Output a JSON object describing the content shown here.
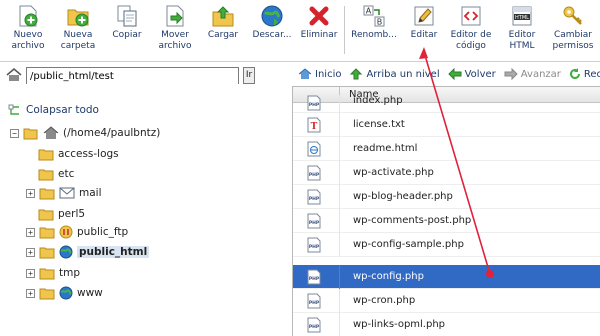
{
  "toolbar": {
    "items": [
      {
        "label": "Nuevo\narchivo",
        "icon": "new-file-icon"
      },
      {
        "label": "Nueva\ncarpeta",
        "icon": "new-folder-icon"
      },
      {
        "label": "Copiar",
        "icon": "copy-icon"
      },
      {
        "label": "Mover\narchivo",
        "icon": "move-file-icon"
      },
      {
        "label": "Cargar",
        "icon": "upload-icon"
      },
      {
        "label": "Descar...",
        "icon": "download-icon"
      },
      {
        "label": "Eliminar",
        "icon": "delete-icon"
      },
      {
        "label": "Renomb...",
        "icon": "rename-icon"
      },
      {
        "label": "Editar",
        "icon": "edit-icon"
      },
      {
        "label": "Editor de\ncódigo",
        "icon": "code-editor-icon"
      },
      {
        "label": "Editor\nHTML",
        "icon": "html-editor-icon"
      },
      {
        "label": "Cambiar\npermisos",
        "icon": "permissions-icon"
      }
    ]
  },
  "path": {
    "value": "/public_html/test",
    "go_label": "Ir"
  },
  "tree": {
    "collapse_label": "Colapsar todo",
    "root_label": "(/home4/paulbntz)",
    "items": [
      {
        "label": "access-logs",
        "expandable": false,
        "type": "folder"
      },
      {
        "label": "etc",
        "expandable": false,
        "type": "folder"
      },
      {
        "label": "mail",
        "expandable": true,
        "type": "mail"
      },
      {
        "label": "perl5",
        "expandable": false,
        "type": "folder"
      },
      {
        "label": "public_ftp",
        "expandable": true,
        "type": "ftp"
      },
      {
        "label": "public_html",
        "expandable": true,
        "type": "web",
        "selected": true
      },
      {
        "label": "tmp",
        "expandable": true,
        "type": "folder"
      },
      {
        "label": "www",
        "expandable": true,
        "type": "web"
      }
    ]
  },
  "nav": {
    "home": "Inicio",
    "up": "Arriba un nivel",
    "back": "Volver",
    "forward": "Avanzar",
    "reload": "Rec"
  },
  "files": {
    "column_name": "Name",
    "rows": [
      {
        "name": "index.php",
        "icon": "php-file-icon"
      },
      {
        "name": "license.txt",
        "icon": "text-file-icon"
      },
      {
        "name": "readme.html",
        "icon": "html-file-icon"
      },
      {
        "name": "wp-activate.php",
        "icon": "php-file-icon"
      },
      {
        "name": "wp-blog-header.php",
        "icon": "php-file-icon"
      },
      {
        "name": "wp-comments-post.php",
        "icon": "php-file-icon"
      },
      {
        "name": "wp-config-sample.php",
        "icon": "php-file-icon"
      },
      {
        "name": "wp-config.php",
        "icon": "php-file-icon",
        "selected": true
      },
      {
        "name": "wp-cron.php",
        "icon": "php-file-icon"
      },
      {
        "name": "wp-links-opml.php",
        "icon": "php-file-icon"
      }
    ]
  },
  "colors": {
    "selected_row": "#316ac5",
    "annotation_arrow": "#e0223a",
    "toolbar_text": "#1f3a6a"
  }
}
